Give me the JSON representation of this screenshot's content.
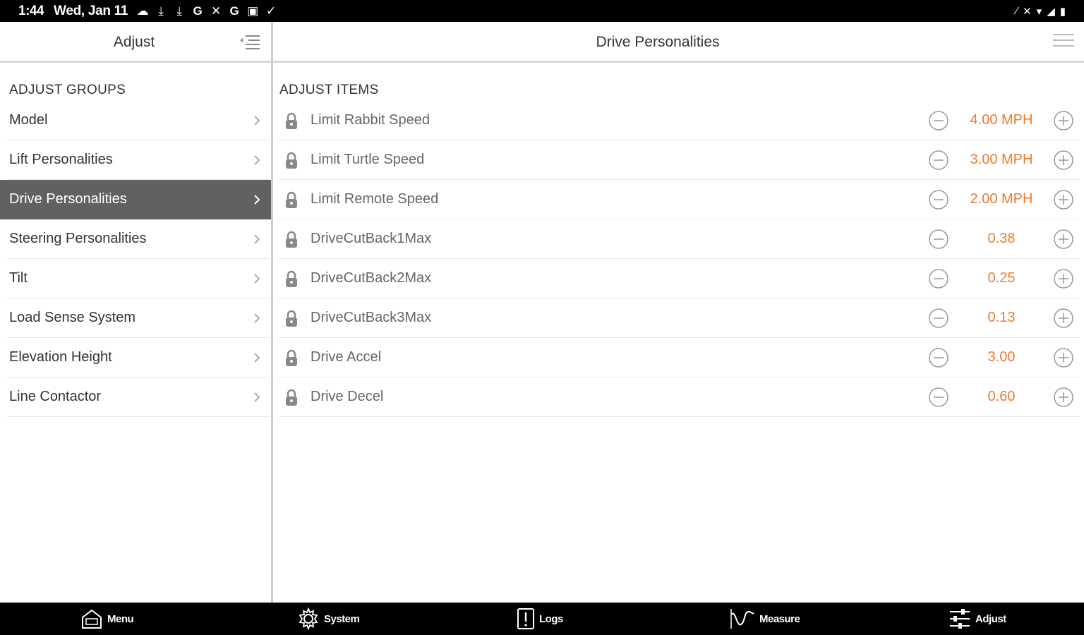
{
  "status_bar": {
    "time": "1:44",
    "date": "Wed, Jan 11",
    "notification_icons": [
      "cloud-icon",
      "download-icon",
      "download-icon",
      "google-icon",
      "crossed-tools-icon",
      "google-icon",
      "image-icon",
      "check-icon"
    ],
    "system_icons": [
      "signal-slash-icon",
      "mute-icon",
      "wifi-icon",
      "cell-signal-icon",
      "battery-icon"
    ]
  },
  "left_panel": {
    "title": "Adjust",
    "section_label": "ADJUST GROUPS",
    "groups": [
      {
        "label": "Model",
        "active": false
      },
      {
        "label": "Lift Personalities",
        "active": false
      },
      {
        "label": "Drive Personalities",
        "active": true
      },
      {
        "label": "Steering Personalities",
        "active": false
      },
      {
        "label": "Tilt",
        "active": false
      },
      {
        "label": "Load Sense System",
        "active": false
      },
      {
        "label": "Elevation Height",
        "active": false
      },
      {
        "label": "Line Contactor",
        "active": false
      }
    ]
  },
  "right_panel": {
    "title": "Drive Personalities",
    "section_label": "ADJUST ITEMS",
    "items": [
      {
        "label": "Limit Rabbit Speed",
        "value": "4.00 MPH"
      },
      {
        "label": "Limit Turtle Speed",
        "value": "3.00 MPH"
      },
      {
        "label": "Limit Remote Speed",
        "value": "2.00 MPH"
      },
      {
        "label": "DriveCutBack1Max",
        "value": "0.38"
      },
      {
        "label": "DriveCutBack2Max",
        "value": "0.25"
      },
      {
        "label": "DriveCutBack3Max",
        "value": "0.13"
      },
      {
        "label": "Drive Accel",
        "value": "3.00"
      },
      {
        "label": "Drive Decel",
        "value": "0.60"
      }
    ]
  },
  "bottom_nav": [
    {
      "label": "Menu",
      "icon": "home-icon"
    },
    {
      "label": "System",
      "icon": "gear-icon"
    },
    {
      "label": "Logs",
      "icon": "alert-log-icon"
    },
    {
      "label": "Measure",
      "icon": "waveform-icon"
    },
    {
      "label": "Adjust",
      "icon": "sliders-icon"
    }
  ],
  "colors": {
    "accent_value": "#f07a2e",
    "active_row": "#616161",
    "bars": "#000000"
  }
}
